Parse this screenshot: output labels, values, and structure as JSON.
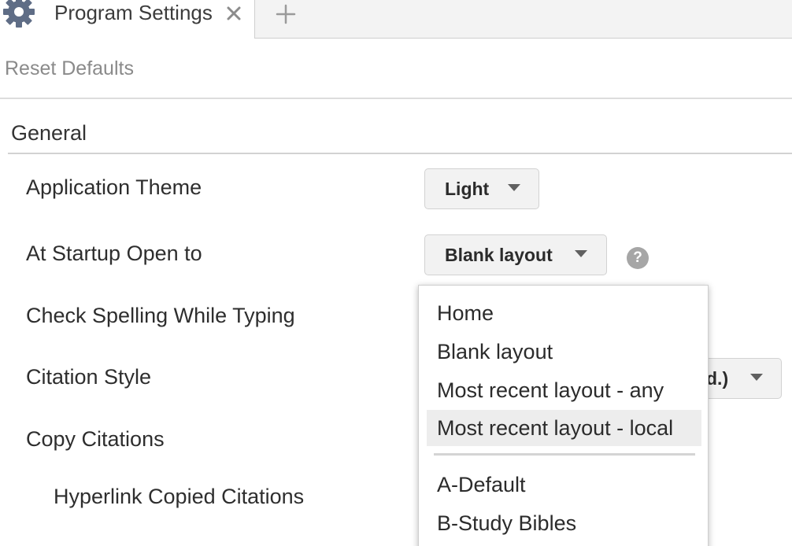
{
  "tab": {
    "title": "Program Settings",
    "icons": {
      "settings": "gear-icon",
      "close": "close-icon",
      "add": "plus-icon"
    }
  },
  "toolbar": {
    "reset_label": "Reset Defaults"
  },
  "section": {
    "heading": "General"
  },
  "settings": {
    "theme": {
      "label": "Application Theme",
      "value": "Light"
    },
    "startup": {
      "label": "At Startup Open to",
      "value": "Blank layout",
      "help": "?"
    },
    "spelling": {
      "label": "Check Spelling While Typing"
    },
    "citation_style": {
      "label": "Citation Style",
      "value_fragment": "d.)"
    },
    "copy_citations": {
      "label": "Copy Citations"
    },
    "hyperlink_citations": {
      "label": "Hyperlink Copied Citations"
    }
  },
  "startup_menu": {
    "items": [
      "Home",
      "Blank layout",
      "Most recent layout - any",
      "Most recent layout - local"
    ],
    "highlighted": "Most recent layout - local",
    "layouts": [
      "A-Default",
      "B-Study Bibles"
    ]
  },
  "colors": {
    "help_icon": "#a6a6a6",
    "menu_highlight": "#ededed",
    "link_gray": "#8a8a8a"
  }
}
